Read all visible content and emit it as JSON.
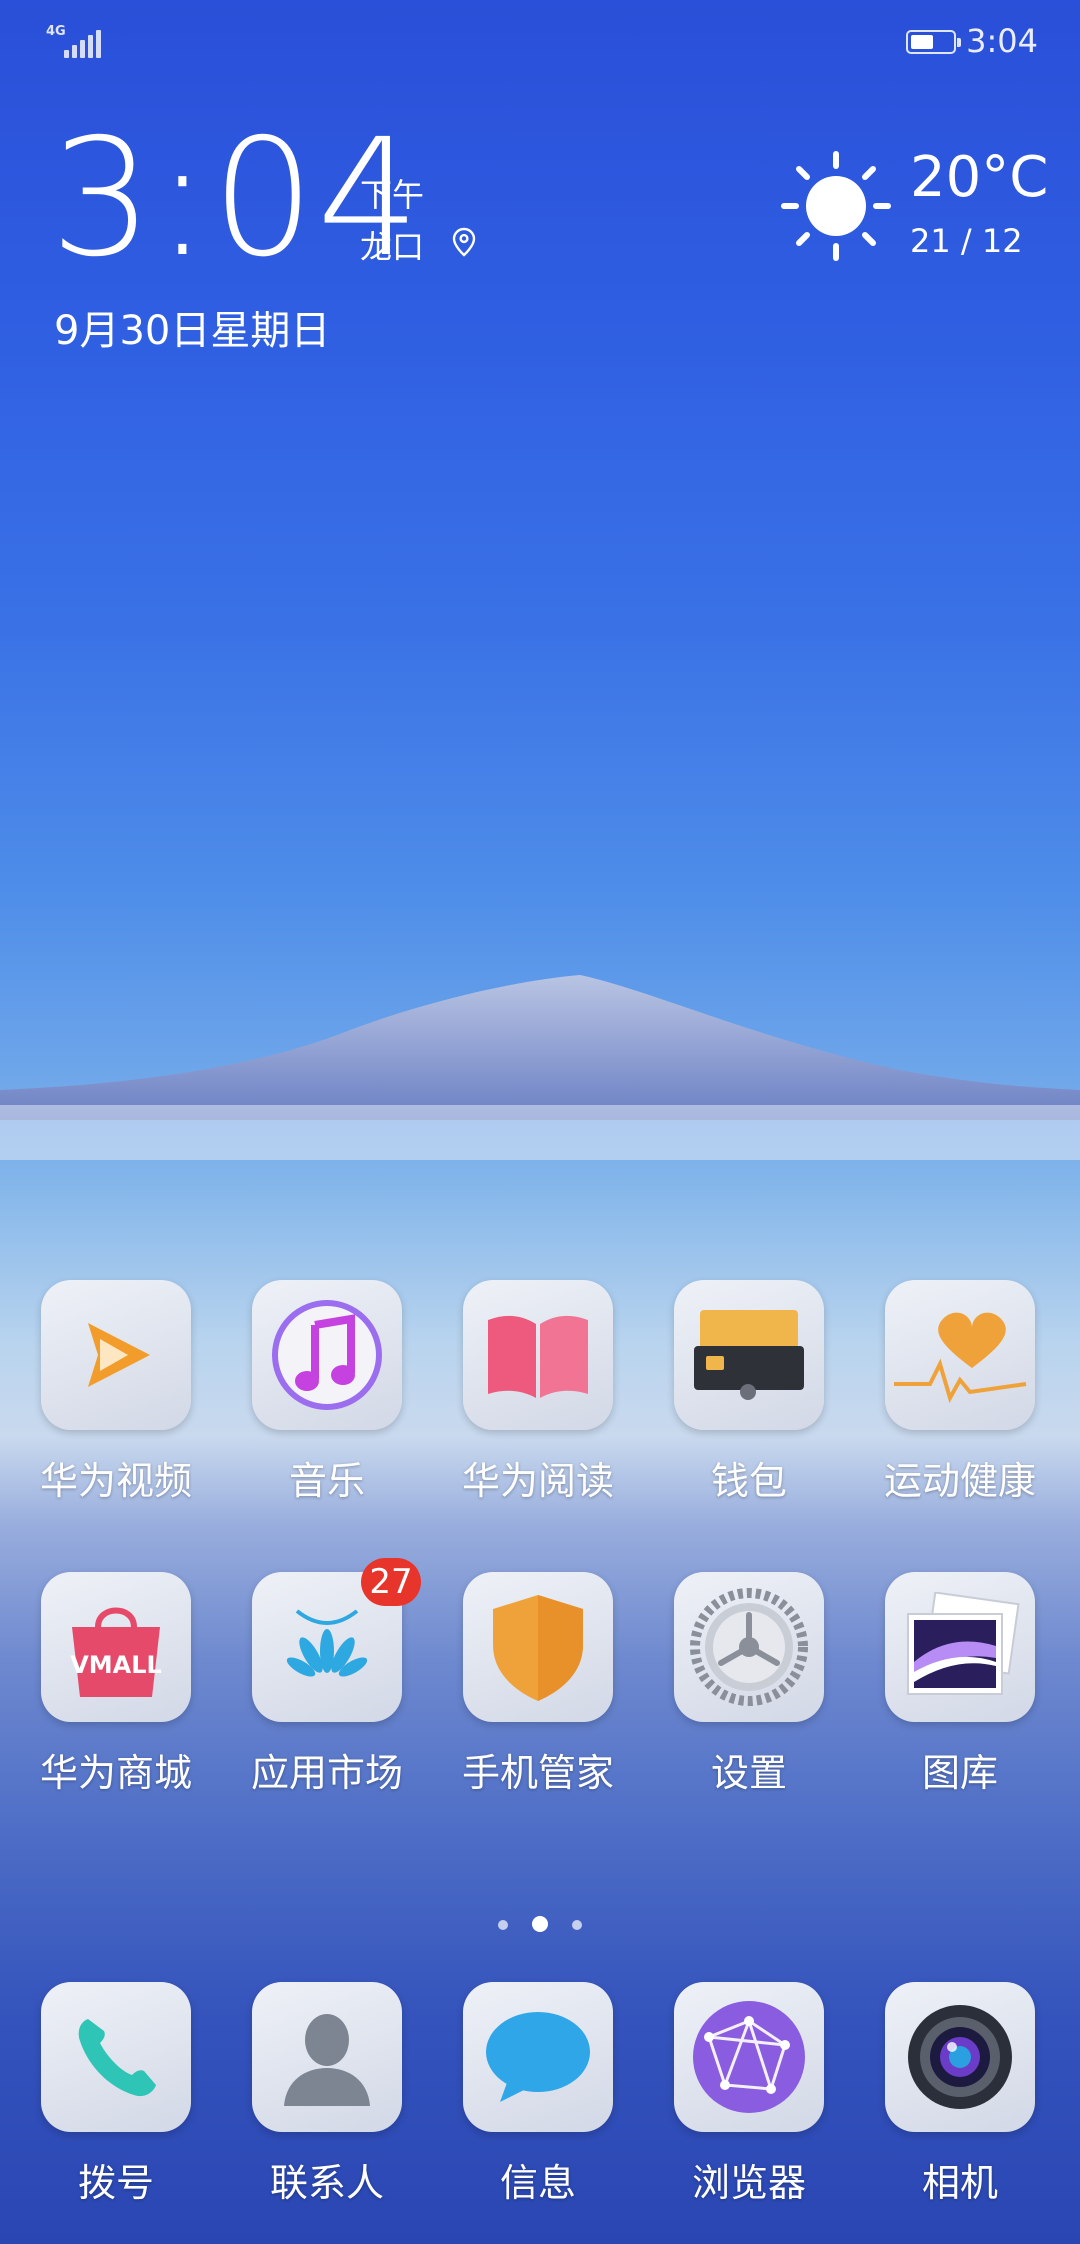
{
  "status_bar": {
    "network": "4G",
    "time": "3:04",
    "battery_level": 0.55
  },
  "clock_widget": {
    "time": "3:04",
    "ampm": "下午",
    "city": "龙口",
    "date": "9月30日星期日"
  },
  "weather_widget": {
    "icon": "sun-icon",
    "temperature": "20°C",
    "range": "21 / 12"
  },
  "apps_row1": [
    {
      "label": "华为视频",
      "icon": "huawei-video-icon",
      "color": "#f29d2b"
    },
    {
      "label": "音乐",
      "icon": "music-icon",
      "color": "#c542e0"
    },
    {
      "label": "华为阅读",
      "icon": "book-icon",
      "color": "#ee5a7e"
    },
    {
      "label": "钱包",
      "icon": "wallet-icon",
      "color": "#f0b64c"
    },
    {
      "label": "运动健康",
      "icon": "health-icon",
      "color": "#f0a23a"
    }
  ],
  "apps_row2": [
    {
      "label": "华为商城",
      "icon": "vmall-icon",
      "color": "#e54a6a",
      "icon_text": "VMALL"
    },
    {
      "label": "应用市场",
      "icon": "app-market-icon",
      "color": "#2ea8e0",
      "badge": "27"
    },
    {
      "label": "手机管家",
      "icon": "shield-icon",
      "color": "#f0a23a"
    },
    {
      "label": "设置",
      "icon": "gear-icon",
      "color": "#8a8f99"
    },
    {
      "label": "图库",
      "icon": "gallery-icon",
      "color": "#6a3cc7"
    }
  ],
  "pages": {
    "count": 3,
    "current": 1
  },
  "dock": [
    {
      "label": "拨号",
      "icon": "phone-icon",
      "color": "#2ec4b6"
    },
    {
      "label": "联系人",
      "icon": "contact-icon",
      "color": "#7d8593"
    },
    {
      "label": "信息",
      "icon": "message-icon",
      "color": "#2ea6e8"
    },
    {
      "label": "浏览器",
      "icon": "browser-icon",
      "color": "#8a5ce0"
    },
    {
      "label": "相机",
      "icon": "camera-icon",
      "color": "#2b2f3a"
    }
  ]
}
